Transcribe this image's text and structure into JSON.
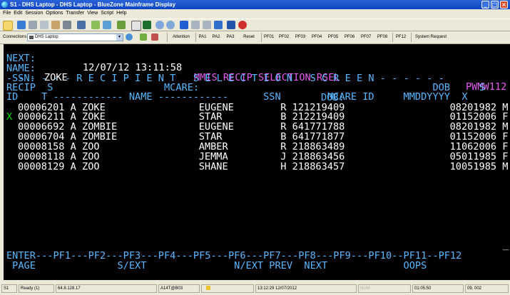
{
  "window": {
    "title": "S1 - DHS Laptop - DHS Laptop - BlueZone Mainframe Display",
    "minimize": "_",
    "maximize": "□",
    "close": "×"
  },
  "menu": [
    "File",
    "Edit",
    "Session",
    "Options",
    "Transfer",
    "View",
    "Script",
    "Help"
  ],
  "toolbar": {
    "connections_label": "Connections:",
    "host": "DHS Laptop",
    "attention": "Attention",
    "keys": [
      "PA1",
      "PA2",
      "PA3",
      "Reset",
      "PF01",
      "PF02",
      "PF03",
      "PF04",
      "PF05",
      "PF06",
      "PF07",
      "PF08",
      "PF12",
      "System Request"
    ]
  },
  "screen": {
    "header_left": "NEXT:",
    "header_datetime": "12/07/12 13:11:58",
    "header_title": "MMIS RECIP SELECTION-RSEL",
    "header_right": "PWMW112",
    "name_label": "NAME:",
    "name_value": "ZOKE",
    "ssn_label": "SSN:",
    "mcare_label": "MCARE:",
    "dob_label": "DOB:",
    "banner": "- - - - - - R E C I P I E N T   S E L E C T I O N   S C R E E N - - - - - -",
    "col_header1": "RECIP  S                                                                 DOB     S",
    "col_header2": "ID    T ------------ NAME ------------      SSN        MCARE ID     MMDDYYYY  X",
    "selection_marker": "X",
    "rows": [
      {
        "text": "00006201 A ZOKE                EUGENE        R 121219409                  08201982 M"
      },
      {
        "text": "00006211 A ZOKE                STAR          B 212219409                  01152006 F"
      },
      {
        "text": "00006692 A ZOMBIE              EUGENE        R 641771788                  08201982 M"
      },
      {
        "text": "00006704 A ZOMBIE              STAR          B 641771877                  01152006 F"
      },
      {
        "text": "00008158 A ZOO                 AMBER         R 218863489                  11062006 F"
      },
      {
        "text": "00008118 A ZOO                 JEMMA         J 218863456                  05011985 F"
      },
      {
        "text": "00008129 A ZOO                 SHANE         H 218863457                  10051985 M"
      }
    ],
    "cursor": "_",
    "pfkeys_line": "ENTER---PF1---PF2---PF3---PF4---PF5---PF6---PF7---PF8---PF9---PF10--PF11--PF12",
    "pfkeys_desc": " PAGE              S/EXT               N/EXT PREV  NEXT             OOPS"
  },
  "statusbar": {
    "session": "S1",
    "ready": "Ready (1)",
    "ip": "64.8.128.17",
    "lu": "A14T@B03",
    "datetime": "13:12:29 12/07/2012",
    "num": "NUM",
    "timer": "01:05:50",
    "cursor_pos": "09, 002"
  }
}
